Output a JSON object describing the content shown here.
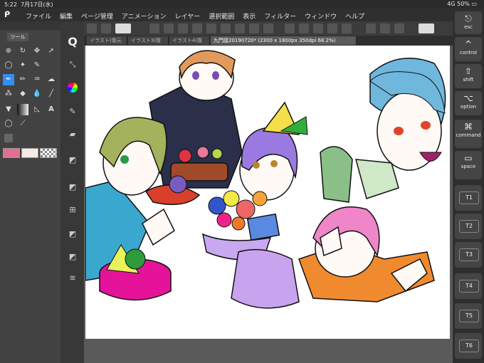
{
  "status": {
    "time": "5:22",
    "date": "7月17日(水)",
    "network": "4G",
    "battery": "50%"
  },
  "menu": {
    "items": [
      "ファイル",
      "編集",
      "ページ管理",
      "アニメーション",
      "レイヤー",
      "選択範囲",
      "表示",
      "フィルター",
      "ウィンドウ",
      "ヘルプ"
    ]
  },
  "tools_panel": {
    "tab_label": "ツール"
  },
  "tabs": [
    {
      "label": "イラスト(復元"
    },
    {
      "label": "イラスト3(復"
    },
    {
      "label": "イラスト4(復"
    },
    {
      "label": "九門誕20190720* (2300 x 1800px 350dpi 68.2%)"
    }
  ],
  "right_keys": [
    {
      "label": "esc",
      "icon": "⎋"
    },
    {
      "label": "control",
      "icon": "^"
    },
    {
      "label": "shift",
      "icon": "⇧"
    },
    {
      "label": "option",
      "icon": "⌥"
    },
    {
      "label": "command",
      "icon": "⌘"
    },
    {
      "label": "space",
      "icon": "▭"
    }
  ],
  "shortcut_keys": [
    "T1",
    "T2",
    "T3",
    "T4",
    "T5",
    "T6"
  ],
  "colors": {
    "main": "#e0708f",
    "sub": "#f3ebe4",
    "accent": "#2f8ff2"
  }
}
